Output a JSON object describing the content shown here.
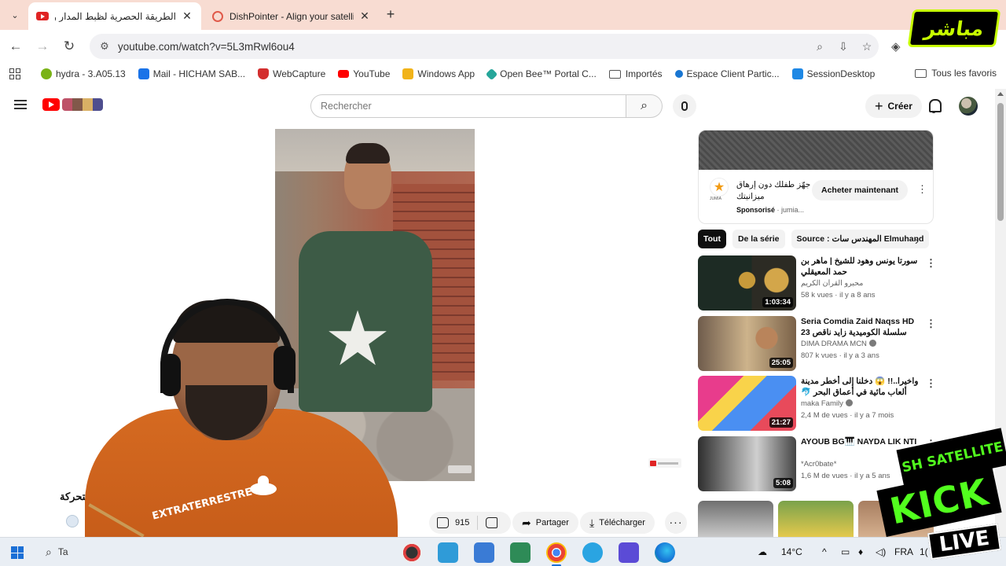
{
  "browser": {
    "tabs": [
      {
        "title": "الطريقة الحصرية لظبط المدار وظ",
        "active": true
      },
      {
        "title": "DishPointer - Align your satellit",
        "active": false
      }
    ],
    "url": "youtube.com/watch?v=5L3mRwl6ou4",
    "bookmarks": [
      {
        "label": "hydra - 3.A05.13",
        "color": "#7ab317"
      },
      {
        "label": "Mail - HICHAM SAB...",
        "color": "#1a73e8"
      },
      {
        "label": "WebCapture",
        "color": "#d32f2f"
      },
      {
        "label": "YouTube",
        "color": "#ff0000"
      },
      {
        "label": "Windows App",
        "color": "#f1b319"
      },
      {
        "label": "Open Bee™ Portal C...",
        "color": "#26a69a"
      },
      {
        "label": "Importés",
        "color": "folder"
      },
      {
        "label": "Espace Client Partic...",
        "color": "#1976d2"
      },
      {
        "label": "SessionDesktop",
        "color": "#1e88e5"
      }
    ],
    "bookmarks_right": "Tous les favoris"
  },
  "youtube": {
    "search_placeholder": "Rechercher",
    "create_label": "Créer",
    "video": {
      "title_fragment": "اق المتحركة",
      "likes": "915",
      "share_label": "Partager",
      "download_label": "Télécharger"
    },
    "ad": {
      "text": "جهّز طفلك دون إرهاق ميزانيتك",
      "sponsored": "Sponsorisé",
      "advertiser": "jumia...",
      "logo_caption": "JUMIA",
      "cta": "Acheter maintenant"
    },
    "chips": [
      "Tout",
      "De la série",
      "Source : المهندس سات Elmuhand"
    ],
    "recommendations": [
      {
        "title": "سورتا يونس وهود للشيخ | ماهر بن حمد المعيقلي",
        "channel": "محبرو القرآن الكريم",
        "views": "58 k vues",
        "age": "il y a 8 ans",
        "duration": "1:03:34",
        "verified": false
      },
      {
        "title": "Seria Comdia Zaid Naqss HD 23 سلسلة الكوميدية زايد ناقص حلقة",
        "channel": "DIMA DRAMA MCN",
        "views": "807 k vues",
        "age": "il y a 3 ans",
        "duration": "25:05",
        "verified": true
      },
      {
        "title": "واخيرا..!! 😱 دخلنا إلى أخطر مدينة ألعاب مائية في أعماق البحر 🐬 😱 (رانيا ...",
        "channel": "maka Family",
        "views": "2,4 M de vues",
        "age": "il y a 7 mois",
        "duration": "21:27",
        "verified": true
      },
      {
        "title": "AYOUB BG🎹 NAYDA LIK NTI",
        "channel": "*Acr0bate*",
        "views": "1,6 M de vues",
        "age": "il y a 5 ans",
        "duration": "5:08",
        "verified": false
      }
    ]
  },
  "overlays": {
    "mubashir": "مباشر",
    "shirt_text": "EXTRATERRESTRE",
    "sat_label": "SH SATELLITE",
    "kick_label": "KICK",
    "live_label": "LIVE"
  },
  "taskbar": {
    "search_label": "Ta",
    "temperature": "14°C",
    "language": "FRA",
    "clock_fragment": "1("
  }
}
